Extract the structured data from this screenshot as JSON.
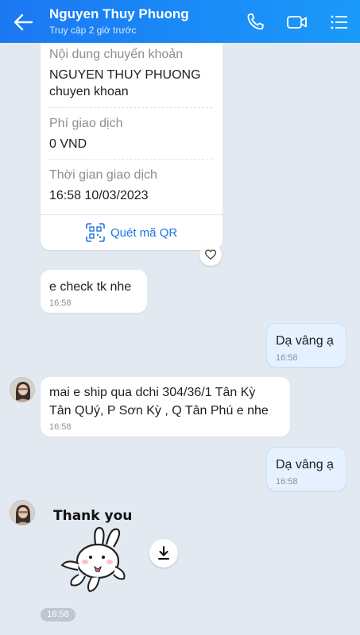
{
  "header": {
    "contact_name": "Nguyen Thuy Phuong",
    "status": "Truy cập 2 giờ trước",
    "back_icon": "arrow-left-icon",
    "call_icon": "phone-icon",
    "video_icon": "video-camera-icon",
    "menu_icon": "list-menu-icon"
  },
  "transfer_card": {
    "content_label": "Nội dung chuyển khoản",
    "content_value_line1": "NGUYEN THUY PHUONG",
    "content_value_line2": "chuyen khoan",
    "fee_label": "Phí giao dịch",
    "fee_value": "0 VND",
    "time_label": "Thời gian giao dịch",
    "time_value": "16:58 10/03/2023",
    "qr_label": "Quét mã QR"
  },
  "messages": [
    {
      "direction": "incoming",
      "text": "e check tk nhe",
      "time": "16:58"
    },
    {
      "direction": "outgoing",
      "text": "Dạ vâng ạ",
      "time": "16:58"
    },
    {
      "direction": "incoming",
      "text_line1": "mai e ship qua dchi 304/36/1 Tân Kỳ",
      "text_line2": "Tân QUý, P Sơn Kỳ , Q Tân Phú e nhe",
      "time": "16:58"
    },
    {
      "direction": "outgoing",
      "text": "Dạ vâng ạ",
      "time": "16:58"
    }
  ],
  "sticker": {
    "caption": "Thank you",
    "time": "16:58"
  },
  "colors": {
    "header": "#1b78f2",
    "background": "#e2e9f1",
    "outgoing_bubble": "#e5f1ff",
    "link": "#1a73e8"
  }
}
